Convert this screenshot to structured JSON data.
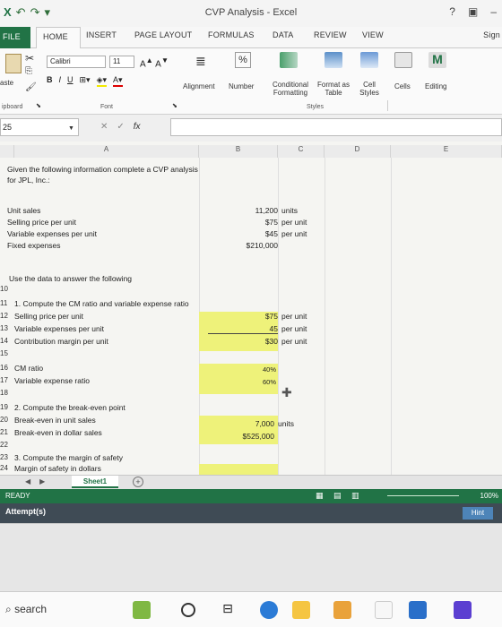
{
  "window": {
    "title": "CVP Analysis - Excel",
    "help_label": "?"
  },
  "tabs": {
    "file": "FILE",
    "home": "HOME",
    "insert": "INSERT",
    "page_layout": "PAGE LAYOUT",
    "formulas": "FORMULAS",
    "data": "DATA",
    "review": "REVIEW",
    "view": "VIEW",
    "signin": "Sign"
  },
  "ribbon": {
    "font_name": "Calibri",
    "font_size": "11",
    "bold": "B",
    "italic": "I",
    "underline": "U",
    "alignment": "Alignment",
    "number": "Number",
    "conditional_formatting_l1": "Conditional",
    "conditional_formatting_l2": "Formatting",
    "format_as_table_l1": "Format as",
    "format_as_table_l2": "Table",
    "cell_styles_l1": "Cell",
    "cell_styles_l2": "Styles",
    "styles_group": "Styles",
    "cells": "Cells",
    "editing": "Editing",
    "paste": "aste",
    "clipboard_group": "ipboard",
    "font_group": "Font"
  },
  "formula_bar": {
    "name_box": "25",
    "fx": "fx",
    "value": ""
  },
  "columns": [
    "A",
    "B",
    "C",
    "D",
    "E"
  ],
  "cells": {
    "intro_l1": "Given the following information complete a CVP analysis",
    "intro_l2": "for JPL, Inc.:",
    "unit_sales_label": "Unit sales",
    "unit_sales_value": "11,200",
    "unit_sales_unit": "units",
    "selling_price_label": "Selling price per unit",
    "selling_price_value": "$75",
    "selling_price_unit": "per unit",
    "variable_exp_label": "Variable expenses per unit",
    "variable_exp_value": "$45",
    "variable_exp_unit": "per unit",
    "fixed_exp_label": "Fixed expenses",
    "fixed_exp_value": "$210,000",
    "use_data": "Use the data to answer the following",
    "q1": "1. Compute the CM ratio and variable expense ratio",
    "q1_sp_label": "Selling price per unit",
    "q1_sp_value": "$75",
    "q1_sp_unit": "per unit",
    "q1_ve_label": "Variable expenses per unit",
    "q1_ve_value": "45",
    "q1_ve_unit": "per unit",
    "q1_cm_label": "Contribution margin per unit",
    "q1_cm_value": "$30",
    "q1_cm_unit": "per unit",
    "cm_ratio_label": "CM ratio",
    "cm_ratio_value": "40%",
    "ve_ratio_label": "Variable expense ratio",
    "ve_ratio_value": "60%",
    "q2": "2. Compute the break-even point",
    "be_units_label": "Break-even in unit sales",
    "be_units_value": "7,000",
    "be_units_unit": "units",
    "be_dollars_label": "Break-even in dollar sales",
    "be_dollars_value": "$525,000",
    "q3": "3. Compute the margin of safety",
    "mos_label": "Margin of safety in dollars"
  },
  "row_numbers": {
    "r10": "10",
    "r11": "11",
    "r12": "12",
    "r13": "13",
    "r14": "14",
    "r15": "15",
    "r16": "16",
    "r17": "17",
    "r18": "18",
    "r19": "19",
    "r20": "20",
    "r21": "21",
    "r22": "22",
    "r23": "23",
    "r24": "24"
  },
  "sheet_tabs": {
    "active": "Sheet1",
    "add": "+"
  },
  "status": {
    "ready": "READY",
    "zoom": "100%"
  },
  "attempts": {
    "label": "Attempt(s)",
    "hint": "Hint"
  },
  "taskbar": {
    "search": "search"
  },
  "colors": {
    "excel_green": "#217346",
    "highlight_yellow": "#eef27a"
  }
}
